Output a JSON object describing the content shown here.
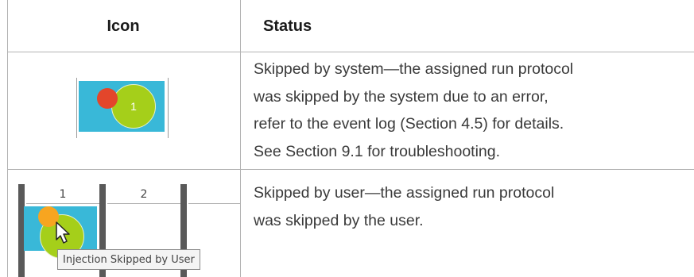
{
  "header": {
    "icon_col": "Icon",
    "status_col": "Status"
  },
  "rows": [
    {
      "icon": {
        "semantic": "skipped-by-system-icon",
        "well_number": "1",
        "colors": {
          "cell": "#39b8d8",
          "circle": "#a5cf1a",
          "dot": "#e3462b"
        }
      },
      "lines": [
        "Skipped by system—the assigned run protocol",
        "was skipped by the system due to an error,",
        "refer to the event log (Section 4.5) for details.",
        "See Section 9.1 for troubleshooting."
      ]
    },
    {
      "icon": {
        "semantic": "skipped-by-user-icon",
        "column_headers": [
          "1",
          "2"
        ],
        "tooltip": "Injection Skipped by User",
        "colors": {
          "cell": "#39b8d8",
          "circle": "#a5cf1a",
          "dot": "#f7a520"
        }
      },
      "lines": [
        "Skipped by user—the assigned run protocol",
        "was skipped by the user."
      ]
    }
  ]
}
